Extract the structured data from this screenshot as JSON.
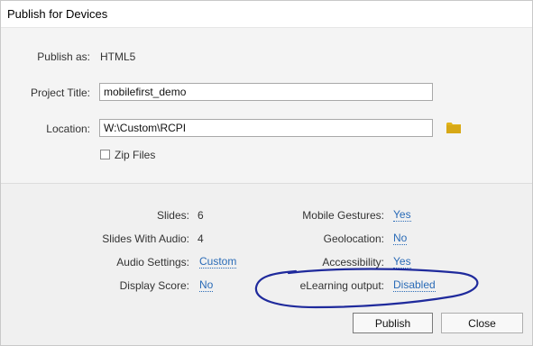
{
  "window": {
    "title": "Publish for Devices"
  },
  "form": {
    "publish_as_label": "Publish as:",
    "publish_as_value": "HTML5",
    "project_title_label": "Project Title:",
    "project_title_value": "mobilefirst_demo",
    "location_label": "Location:",
    "location_value": "W:\\Custom\\RCPI",
    "zip_files_label": "Zip Files",
    "zip_files_checked": false
  },
  "summary": {
    "left": [
      {
        "label": "Slides:",
        "value": "6",
        "link": false
      },
      {
        "label": "Slides With Audio:",
        "value": "4",
        "link": false
      },
      {
        "label": "Audio Settings:",
        "value": "Custom",
        "link": true
      },
      {
        "label": "Display Score:",
        "value": "No",
        "link": true
      }
    ],
    "right": [
      {
        "label": "Mobile Gestures:",
        "value": "Yes",
        "link": true
      },
      {
        "label": "Geolocation:",
        "value": "No",
        "link": true
      },
      {
        "label": "Accessibility:",
        "value": "Yes",
        "link": true
      },
      {
        "label": "eLearning output:",
        "value": "Disabled",
        "link": true
      }
    ]
  },
  "buttons": {
    "publish": "Publish",
    "close": "Close"
  },
  "icons": {
    "folder": "folder-icon"
  },
  "colors": {
    "link": "#2a6bb7",
    "annotation": "#1f2a9c",
    "folder": "#e2b419"
  }
}
